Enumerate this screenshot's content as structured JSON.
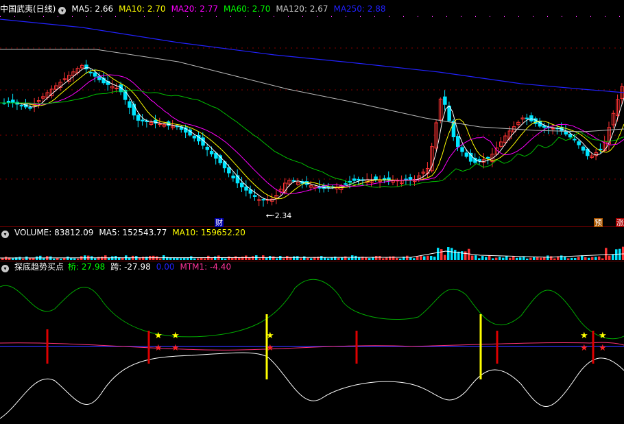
{
  "main_chart": {
    "stock_name": "中国武夷(日线)",
    "ma_items": [
      {
        "label": "MA5: 2.66",
        "color": "#ffffff"
      },
      {
        "label": "MA10: 2.70",
        "color": "#ffff00"
      },
      {
        "label": "MA20: 2.77",
        "color": "#ff00ff"
      },
      {
        "label": "MA60: 2.70",
        "color": "#00ff00"
      },
      {
        "label": "MA120: 2.67",
        "color": "#c8c8c8"
      },
      {
        "label": "MA250: 2.88",
        "color": "#2020ff"
      }
    ],
    "low_label": "2.34",
    "markers": [
      "财",
      "预",
      "涨"
    ]
  },
  "volume_panel": {
    "items": [
      {
        "label": "VOLUME: 83812.09",
        "color": "#ffffff"
      },
      {
        "label": "MA5: 152543.77",
        "color": "#ffffff"
      },
      {
        "label": "MA10: 159652.20",
        "color": "#ffff00"
      }
    ]
  },
  "indicator_panel": {
    "title": "探底趋势买点",
    "items": [
      {
        "label": "桥: 27.98",
        "color": "#00ff00"
      },
      {
        "label": "跨: -27.98",
        "color": "#ffffff"
      },
      {
        "label": "0.00",
        "color": "#2020ff"
      },
      {
        "label": "MTM1: -4.40",
        "color": "#ff3399"
      }
    ]
  },
  "colors": {
    "up": "#ff3333",
    "down": "#00e5ff",
    "grid": "#8b0000",
    "background": "#000000"
  }
}
